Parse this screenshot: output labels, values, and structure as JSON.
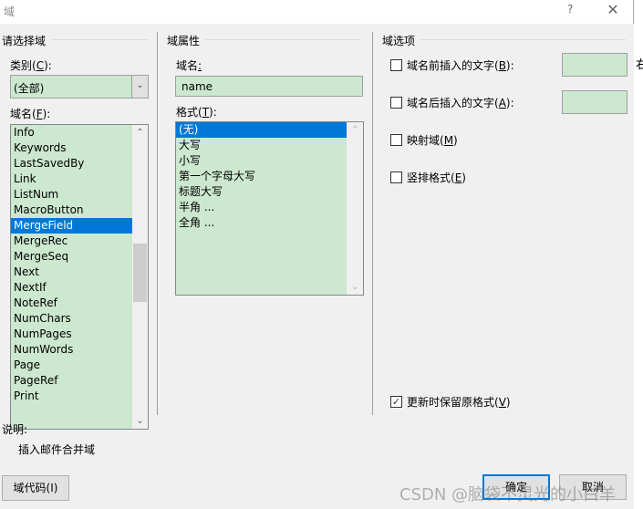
{
  "window": {
    "title": "域",
    "help_label": "?",
    "close_label": "✕"
  },
  "outside_text": "右",
  "select_field": {
    "group_title": "请选择域",
    "category_label": "类别(",
    "category_key": "C",
    "category_suffix": "):",
    "category_value": "(全部)",
    "field_names_label": "域名(",
    "field_names_key": "F",
    "field_names_suffix": "):",
    "field_names": [
      "Info",
      "Keywords",
      "LastSavedBy",
      "Link",
      "ListNum",
      "MacroButton",
      "MergeField",
      "MergeRec",
      "MergeSeq",
      "Next",
      "NextIf",
      "NoteRef",
      "NumChars",
      "NumPages",
      "NumWords",
      "Page",
      "PageRef",
      "Print"
    ],
    "selected_field": "MergeField",
    "scroll_position_fraction": 0.48
  },
  "field_properties": {
    "group_title": "域属性",
    "name_label": "域名",
    "name_suffix": ":",
    "name_value": "name",
    "format_label": "格式(",
    "format_key": "T",
    "format_suffix": "):",
    "formats": [
      "(无)",
      "大写",
      "小写",
      "第一个字母大写",
      "标题大写",
      "半角 ...",
      "全角 ..."
    ],
    "selected_format": "(无)"
  },
  "field_options": {
    "group_title": "域选项",
    "options": [
      {
        "label": "域名前插入的文字(",
        "key": "B",
        "suffix": "):",
        "checked": false,
        "has_text": true,
        "text": ""
      },
      {
        "label": "域名后插入的文字(",
        "key": "A",
        "suffix": "):",
        "checked": false,
        "has_text": true,
        "text": ""
      },
      {
        "label": "映射域(",
        "key": "M",
        "suffix": ")",
        "checked": false,
        "has_text": false
      },
      {
        "label": "竖排格式(",
        "key": "E",
        "suffix": ")",
        "checked": false,
        "has_text": false
      }
    ],
    "preserve_label": "更新时保留原格式(",
    "preserve_key": "V",
    "preserve_suffix": ")",
    "preserve_checked": true
  },
  "description": {
    "label": "说明:",
    "text": "插入邮件合并域"
  },
  "buttons": {
    "field_codes": "域代码(I)",
    "ok": "确定",
    "cancel": "取消"
  },
  "watermark": "CSDN @脑袋不灵光的小白羊",
  "colors": {
    "field_bg": "#cce8cf",
    "selection": "#0078d7",
    "dialog_bg": "#f0f0f0"
  }
}
